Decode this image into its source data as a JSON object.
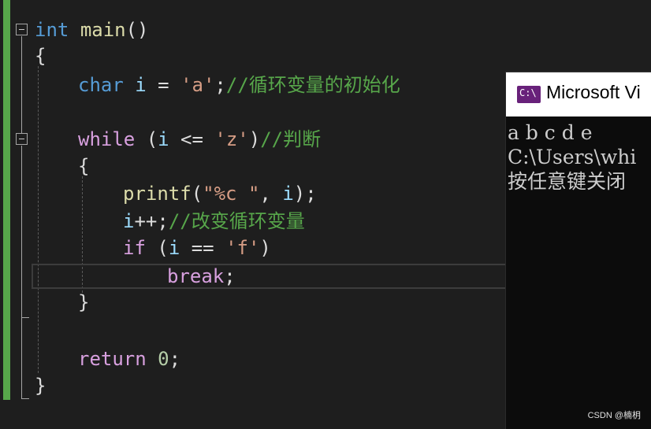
{
  "code": {
    "line1": {
      "type": "int",
      "fn": "main",
      "rest": "()"
    },
    "line2": "{",
    "line3": {
      "type": "char",
      "var": "i",
      "op": " = ",
      "str": "'a'",
      "semi": ";",
      "comment": "//循环变量的初始化"
    },
    "line4": {
      "kw": "while",
      "open": " (",
      "var": "i",
      "op": " <= ",
      "str": "'z'",
      "close": ")",
      "comment": "//判断"
    },
    "line5": "{",
    "line6": {
      "fn": "printf",
      "open": "(",
      "str": "\"%c \"",
      "comma": ", ",
      "var": "i",
      "close": ");"
    },
    "line7": {
      "var": "i",
      "op": "++;",
      "comment": "//改变循环变量"
    },
    "line8": {
      "kw": "if",
      "open": " (",
      "var": "i",
      "op": " == ",
      "str": "'f'",
      "close": ")"
    },
    "line9": {
      "kw": "break",
      "semi": ";"
    },
    "line10": "}",
    "line11": {
      "kw": "return",
      "num": "0",
      "semi": ";"
    },
    "line12": "}"
  },
  "console": {
    "title": "Microsoft Vi",
    "icon": "console-app-icon",
    "output": [
      "a b c d e",
      "C:\\Users\\whi",
      "按任意键关闭"
    ]
  },
  "watermark": "CSDN @楠枂",
  "colors": {
    "background": "#1e1e1e",
    "keyword": "#569cd6",
    "control_keyword": "#d8a0df",
    "function": "#dcdcaa",
    "variable": "#9cdcfe",
    "string": "#d69d85",
    "comment": "#57a64a",
    "number": "#b5cea8",
    "change_bar": "#57a64a"
  }
}
